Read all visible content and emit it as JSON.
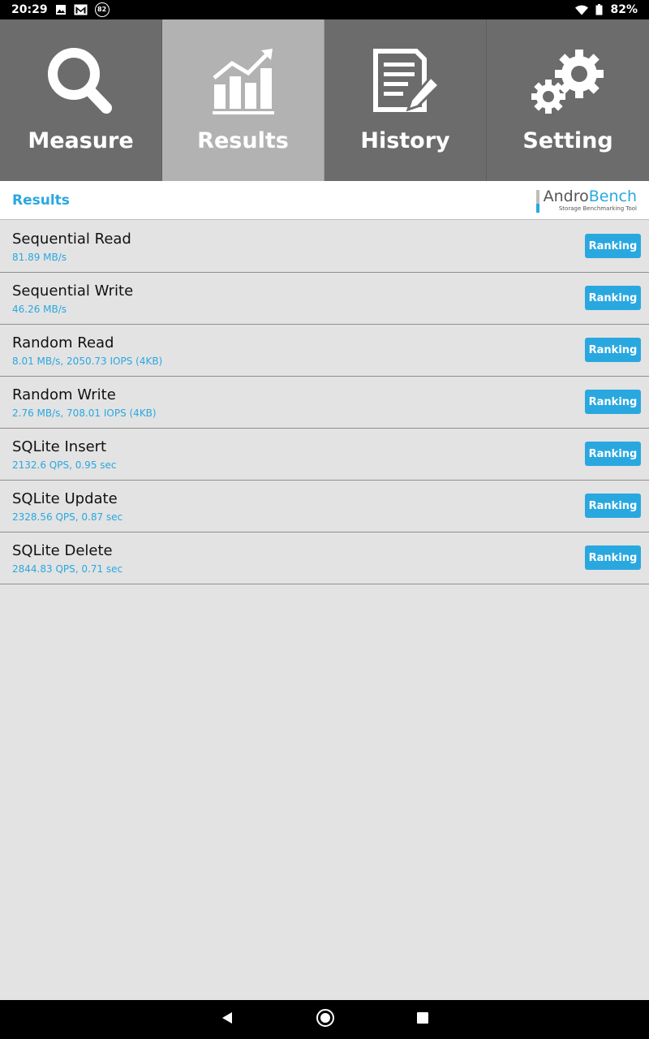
{
  "status_bar": {
    "time": "20:29",
    "notification_badge": "82",
    "battery_percent": "82%"
  },
  "tabs": [
    {
      "label": "Measure",
      "icon": "magnifier-icon",
      "active": false
    },
    {
      "label": "Results",
      "icon": "chart-trend-icon",
      "active": true
    },
    {
      "label": "History",
      "icon": "document-pen-icon",
      "active": false
    },
    {
      "label": "Setting",
      "icon": "gears-icon",
      "active": false
    }
  ],
  "header": {
    "title": "Results",
    "logo_main_part1": "Andro",
    "logo_main_part2": "Bench",
    "logo_sub": "Storage Benchmarking Tool"
  },
  "results": [
    {
      "title": "Sequential Read",
      "value": "81.89 MB/s",
      "button": "Ranking"
    },
    {
      "title": "Sequential Write",
      "value": "46.26 MB/s",
      "button": "Ranking"
    },
    {
      "title": "Random Read",
      "value": "8.01 MB/s, 2050.73 IOPS (4KB)",
      "button": "Ranking"
    },
    {
      "title": "Random Write",
      "value": "2.76 MB/s, 708.01 IOPS (4KB)",
      "button": "Ranking"
    },
    {
      "title": "SQLite Insert",
      "value": "2132.6 QPS, 0.95 sec",
      "button": "Ranking"
    },
    {
      "title": "SQLite Update",
      "value": "2328.56 QPS, 0.87 sec",
      "button": "Ranking"
    },
    {
      "title": "SQLite Delete",
      "value": "2844.83 QPS, 0.71 sec",
      "button": "Ranking"
    }
  ],
  "colors": {
    "accent": "#29a8e0",
    "tab_bg": "#6c6c6c",
    "tab_active_bg": "#b2b2b2",
    "list_bg": "#e3e3e3"
  }
}
